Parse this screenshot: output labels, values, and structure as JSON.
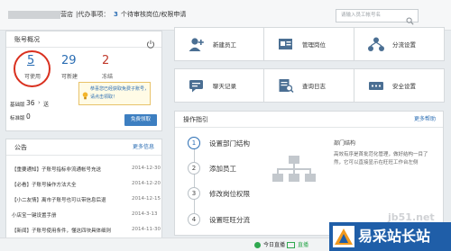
{
  "header": {
    "company_suffix": "营店",
    "todo_prefix": "|代办事项：",
    "todo_count": "3",
    "todo_suffix": "个待审核岗位/权限申请",
    "search_placeholder": "请输入员工帐号名"
  },
  "account": {
    "title": "账号概况",
    "stats": [
      {
        "value": "5",
        "label": "可使用"
      },
      {
        "value": "29",
        "label": "可新建"
      },
      {
        "value": "2",
        "label": "冻结"
      }
    ],
    "tip_text": "恭喜您已经获取免费子账号，请点击领取！",
    "basic_label": "基础版",
    "basic_value": "36",
    "basic_extra": "送",
    "standard_label": "标准版",
    "standard_value": "0",
    "claim_button": "免费领取"
  },
  "announcements": {
    "title": "公告",
    "more": "更多信息",
    "items": [
      {
        "text": "【重要通知】子账号指标非流通帐号充送",
        "date": "2014-12-30"
      },
      {
        "text": "【必看】子账号操作方法大全",
        "date": "2014-12-20"
      },
      {
        "text": "【小二友情】离市子账号也可以带信息后退",
        "date": "2014-12-15"
      },
      {
        "text": "小店宝一键设置手册",
        "date": "2014-3-13"
      },
      {
        "text": "【新闻】子账号使用条件，懂这四块具体细则",
        "date": "2014-11-30"
      }
    ]
  },
  "tiles": [
    {
      "label": "新建员工",
      "icon": "new-employee-icon"
    },
    {
      "label": "管理岗位",
      "icon": "manage-position-icon"
    },
    {
      "label": "分流设置",
      "icon": "diversion-settings-icon"
    },
    {
      "label": "聊天记录",
      "icon": "chat-records-icon"
    },
    {
      "label": "查询日志",
      "icon": "query-log-icon"
    },
    {
      "label": "安全设置",
      "icon": "security-settings-icon"
    }
  ],
  "guide": {
    "title": "操作指引",
    "more": "更多帮助",
    "steps": [
      {
        "num": "1",
        "label": "设置部门结构"
      },
      {
        "num": "2",
        "label": "添加员工"
      },
      {
        "num": "3",
        "label": "修改岗位权限"
      },
      {
        "num": "4",
        "label": "设置旺旺分流"
      }
    ],
    "detail_title": "部门结构",
    "detail_text": "高效有序是首批范化管理，做好结构一目了然，它可以直接显示在旺旺工作台左侧"
  },
  "statusbar": {
    "today_label": "今日直播",
    "live_label": "直播"
  },
  "watermark": {
    "domain": "jb51.net",
    "brand": "易采站长站"
  }
}
